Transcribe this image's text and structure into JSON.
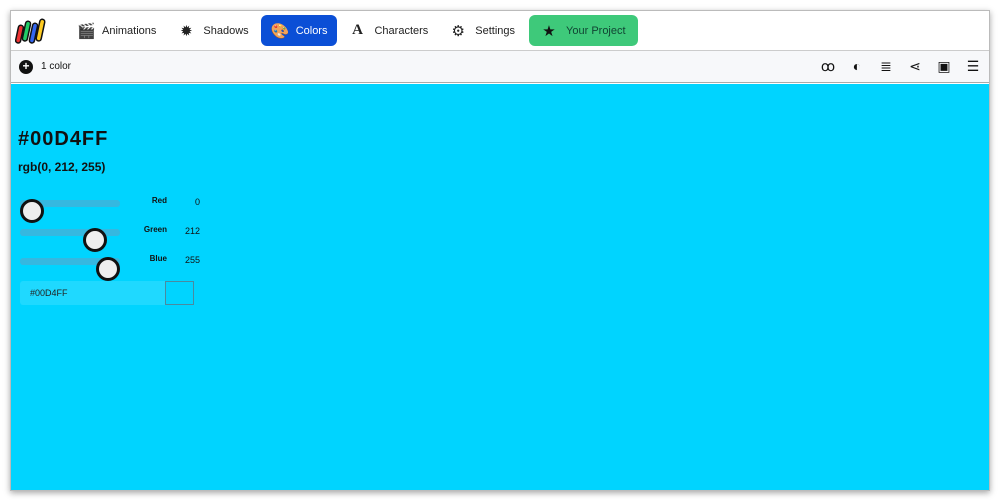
{
  "nav": {
    "items": [
      {
        "label": "Animations",
        "icon": "clapperboard-icon",
        "glyph": "🎬"
      },
      {
        "label": "Shadows",
        "icon": "sun-gear-icon",
        "glyph": "✹"
      },
      {
        "label": "Colors",
        "icon": "palette-icon",
        "glyph": "🎨"
      },
      {
        "label": "Characters",
        "icon": "font-icon",
        "glyph": "A"
      },
      {
        "label": "Settings",
        "icon": "gear-icon",
        "glyph": "⚙"
      }
    ],
    "project": {
      "label": "Your Project",
      "glyph": "★"
    }
  },
  "toolbar": {
    "add_label": "1 color",
    "add_glyph": "+",
    "tools": [
      {
        "name": "glasses-icon",
        "glyph": "ꝏ"
      },
      {
        "name": "contrast-icon",
        "glyph": "◐"
      },
      {
        "name": "scroll-icon",
        "glyph": "≣"
      },
      {
        "name": "share-icon",
        "glyph": "⋖"
      },
      {
        "name": "save-icon",
        "glyph": "▣"
      },
      {
        "name": "menu-icon",
        "glyph": "☰"
      }
    ]
  },
  "color": {
    "hex": "#00D4FF",
    "rgb": "rgb(0, 212, 255)",
    "accent": "#00d4ff",
    "channels": [
      {
        "label": "Red",
        "value": "0",
        "fraction": 0
      },
      {
        "label": "Green",
        "value": "212",
        "fraction": 0.831
      },
      {
        "label": "Blue",
        "value": "255",
        "fraction": 1
      }
    ],
    "input_value": "#00D4FF"
  }
}
